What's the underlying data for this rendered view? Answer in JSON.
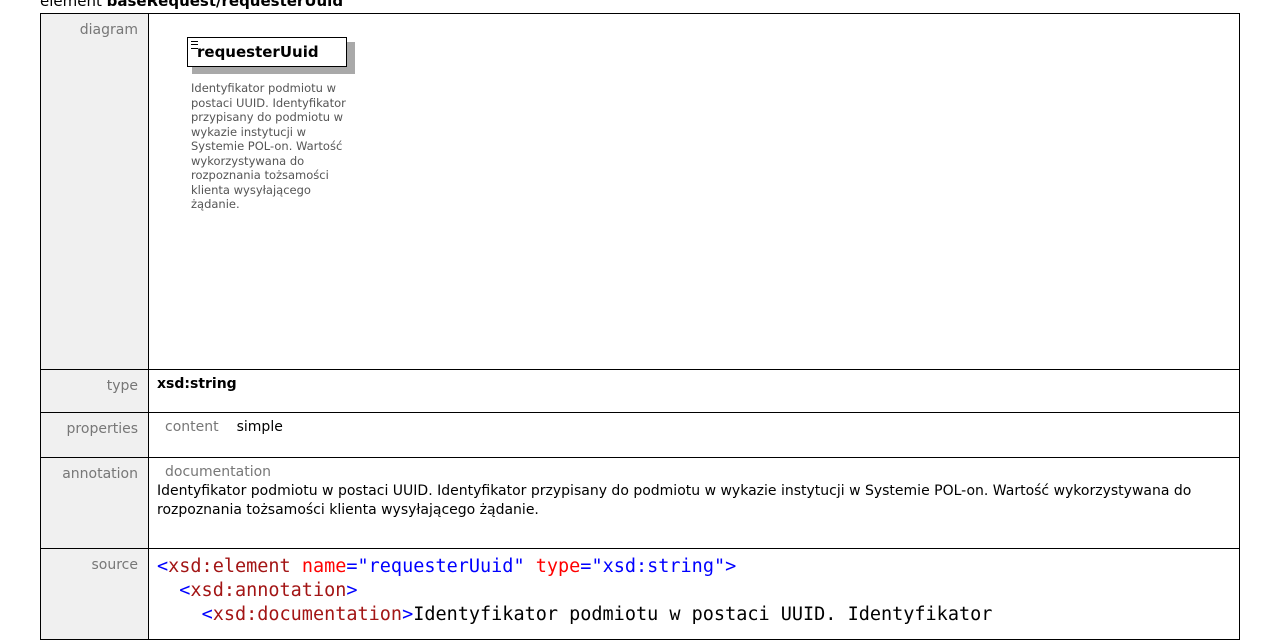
{
  "heading": {
    "prefix": "element",
    "name": "baseRequest/requesterUuid"
  },
  "rows": {
    "diagram": {
      "label": "diagram",
      "element_name": "requesterUuid",
      "doc_lines": [
        "Identyfikator podmiotu w",
        "postaci UUID. Identyfikator",
        "przypisany do podmiotu w",
        "wykazie instytucji w",
        "Systemie POL-on. Wartość",
        "wykorzystywana do",
        "rozpoznania tożsamości",
        "klienta wysyłającego",
        "żądanie."
      ]
    },
    "type": {
      "label": "type",
      "value": "xsd:string"
    },
    "properties": {
      "label": "properties",
      "key": "content",
      "value": "simple"
    },
    "annotation": {
      "label": "annotation",
      "key": "documentation",
      "text": "Identyfikator podmiotu w postaci UUID. Identyfikator przypisany do podmiotu w wykazie instytucji w Systemie POL-on. Wartość wykorzystywana do rozpoznania tożsamości klienta wysyłającego żądanie."
    },
    "source": {
      "label": "source",
      "line1": {
        "open": "<",
        "tag": "xsd:element",
        "attr1": "name",
        "val1": "\"requesterUuid\"",
        "attr2": "type",
        "val2": "\"xsd:string\"",
        "close": ">"
      },
      "line2": {
        "open": "<",
        "tag": "xsd:annotation",
        "close": ">"
      },
      "line3": {
        "open": "<",
        "tag": "xsd:documentation",
        "close": ">",
        "text": "Identyfikator podmiotu w postaci UUID. Identyfikator"
      }
    }
  }
}
